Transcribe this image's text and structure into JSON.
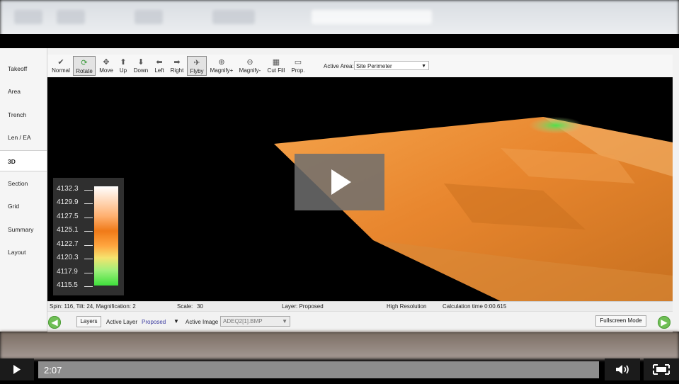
{
  "sidebar": {
    "items": [
      {
        "label": "Takeoff"
      },
      {
        "label": "Area"
      },
      {
        "label": "Trench"
      },
      {
        "label": "Len / EA"
      },
      {
        "label": "3D"
      },
      {
        "label": "Section"
      },
      {
        "label": "Grid"
      },
      {
        "label": "Summary"
      },
      {
        "label": "Layout"
      }
    ],
    "active": "3D"
  },
  "toolbar": {
    "tools": [
      {
        "label": "Normal",
        "icon": "checkmark-icon"
      },
      {
        "label": "Rotate",
        "icon": "rotate-icon",
        "selected": true
      },
      {
        "label": "Move",
        "icon": "move-icon"
      },
      {
        "label": "Up",
        "icon": "arrow-up-icon"
      },
      {
        "label": "Down",
        "icon": "arrow-down-icon"
      },
      {
        "label": "Left",
        "icon": "arrow-left-icon"
      },
      {
        "label": "Right",
        "icon": "arrow-right-icon"
      },
      {
        "label": "Flyby",
        "icon": "flyby-icon",
        "selected": true
      },
      {
        "label": "Magnify+",
        "icon": "zoom-in-icon"
      },
      {
        "label": "Magnify-",
        "icon": "zoom-out-icon"
      },
      {
        "label": "Cut Fill",
        "icon": "cut-fill-icon"
      },
      {
        "label": "Prop.",
        "icon": "properties-icon"
      }
    ],
    "active_area_label": "Active Area:",
    "active_area_value": "Site Perimeter"
  },
  "legend": {
    "values": [
      "4132.3",
      "4129.9",
      "4127.5",
      "4125.1",
      "4122.7",
      "4120.3",
      "4117.9",
      "4115.5"
    ]
  },
  "status": {
    "view": "Spin: 116, Tilt: 24, Magnification: 2",
    "scale_label": "Scale:",
    "scale_value": "30",
    "layer": "Layer: Proposed",
    "resolution": "High Resolution",
    "calc_time": "Calculation time 0:00.615"
  },
  "bottom": {
    "layers_button": "Layers",
    "active_layer_label": "Active Layer",
    "active_layer_value": "Proposed",
    "active_image_label": "Active Image",
    "active_image_value": "ADEQ2[1].BMP",
    "fullscreen_button": "Fullscreen Mode"
  },
  "player": {
    "time": "2:07"
  },
  "colors": {
    "accent_green": "#6fbf55",
    "surface_orange": "#f08a2a",
    "surface_green": "#3ee03c"
  }
}
